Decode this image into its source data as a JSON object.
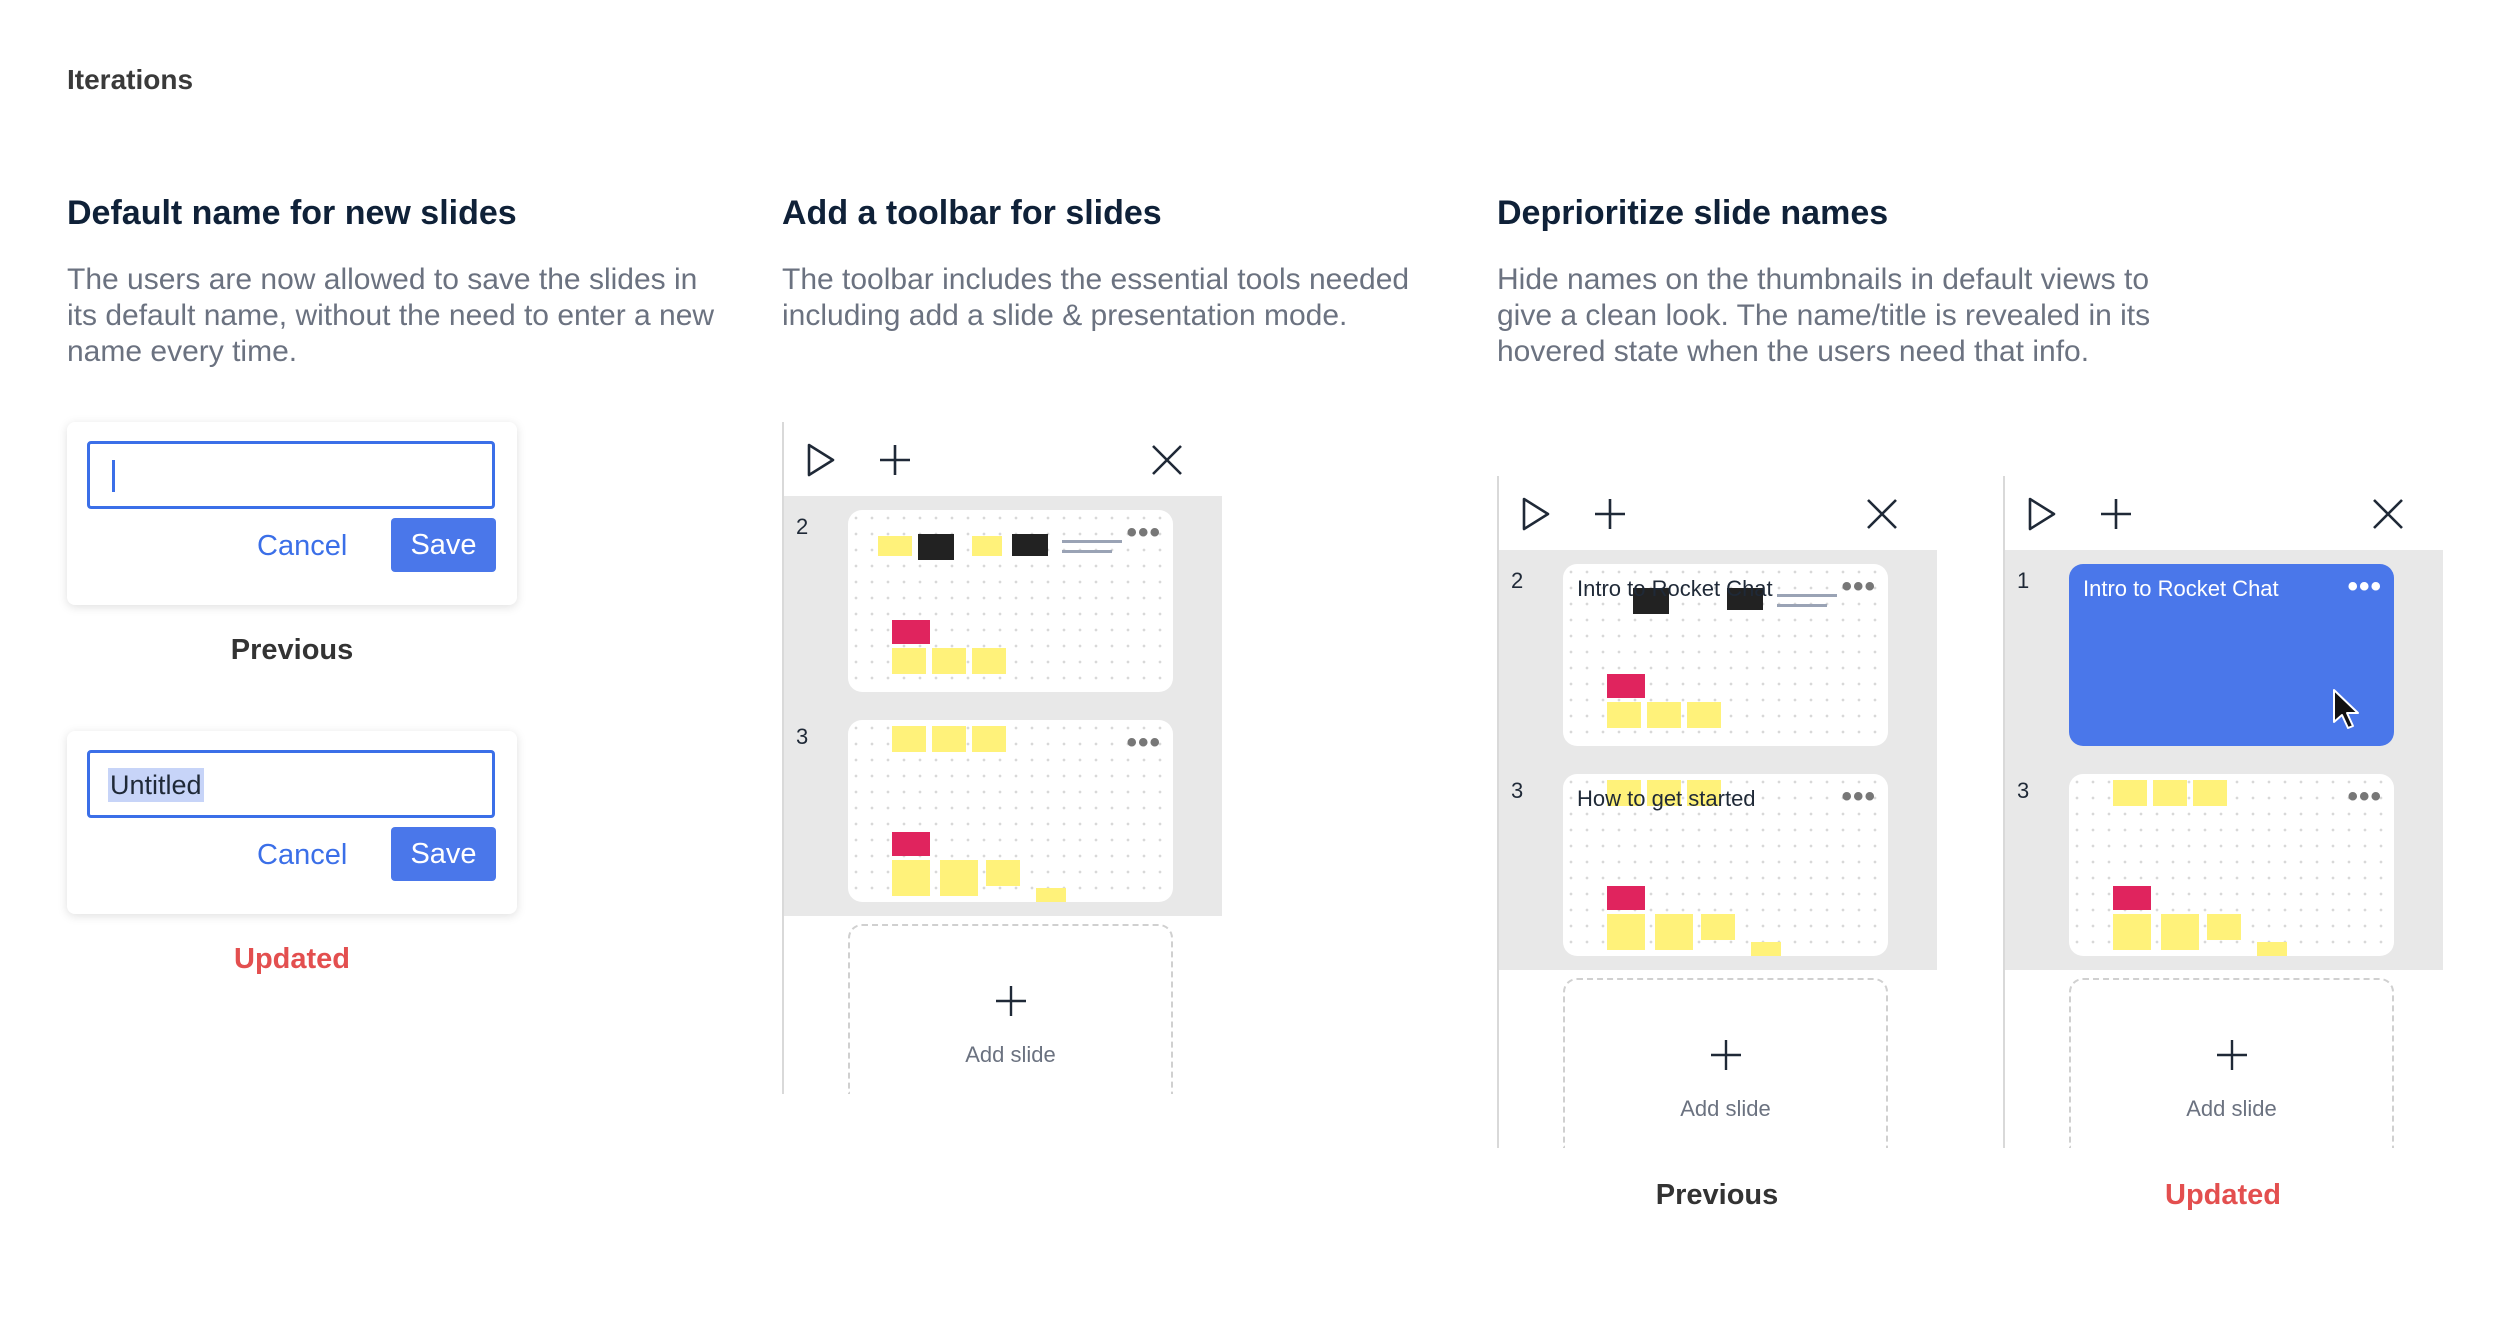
{
  "page_label": "Iterations",
  "sections": [
    {
      "title": "Default name for new slides",
      "description": "The users are now allowed to save the slides in its default name, without the need to enter a new name every time."
    },
    {
      "title": "Add a toolbar for slides",
      "description": "The toolbar includes the essential tools needed including add a slide & presentation mode."
    },
    {
      "title": "Deprioritize slide names",
      "description": "Hide names on the thumbnails in default views to give a clean look. The name/title is revealed in its hovered state when the users need that info."
    }
  ],
  "dialog_previous": {
    "value": "",
    "cancel": "Cancel",
    "save": "Save",
    "caption": "Previous"
  },
  "dialog_updated": {
    "value": "Untitled",
    "cancel": "Cancel",
    "save": "Save",
    "caption": "Updated"
  },
  "toolbar_panel": {
    "slides": [
      {
        "number": "2"
      },
      {
        "number": "3"
      }
    ],
    "add_slide": "Add slide"
  },
  "names_previous": {
    "slides": [
      {
        "number": "2",
        "name": "Intro to Rocket Chat"
      },
      {
        "number": "3",
        "name": "How to get started"
      }
    ],
    "add_slide": "Add slide",
    "caption": "Previous"
  },
  "names_updated": {
    "slides": [
      {
        "number": "1",
        "name": "Intro to Rocket Chat"
      },
      {
        "number": "3",
        "name": ""
      }
    ],
    "add_slide": "Add slide",
    "caption": "Updated"
  },
  "icons": [
    "play-icon",
    "plus-icon",
    "close-icon",
    "more-icon",
    "cursor-icon"
  ],
  "colors": {
    "accent": "#4a77ea",
    "updated": "#e34f4f",
    "title": "#0f2138",
    "sticky": "#fff27a",
    "sticky_pink": "#e0245e"
  }
}
